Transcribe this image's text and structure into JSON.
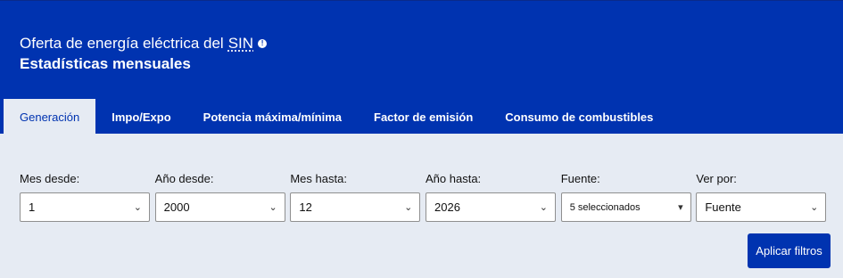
{
  "header": {
    "title": "Oferta de energía eléctrica del",
    "title_abbr": "SIN",
    "info_icon_glyph": "!",
    "subtitle": "Estadísticas mensuales"
  },
  "tabs": [
    {
      "label": "Generación",
      "active": true
    },
    {
      "label": "Impo/Expo",
      "active": false
    },
    {
      "label": "Potencia máxima/mínima",
      "active": false
    },
    {
      "label": "Factor de emisión",
      "active": false
    },
    {
      "label": "Consumo de combustibles",
      "active": false
    }
  ],
  "filters": {
    "mes_desde": {
      "label": "Mes desde:",
      "value": "1"
    },
    "anio_desde": {
      "label": "Año desde:",
      "value": "2000"
    },
    "mes_hasta": {
      "label": "Mes hasta:",
      "value": "12"
    },
    "anio_hasta": {
      "label": "Año hasta:",
      "value": "2026"
    },
    "fuente": {
      "label": "Fuente:",
      "value": "5 seleccionados"
    },
    "ver_por": {
      "label": "Ver por:",
      "value": "Fuente"
    }
  },
  "chevron_glyph": "⌄",
  "caret_glyph": "▾",
  "apply_label": "Aplicar filtros",
  "colors": {
    "brand": "#0033b0",
    "background": "#e6ebf3"
  }
}
